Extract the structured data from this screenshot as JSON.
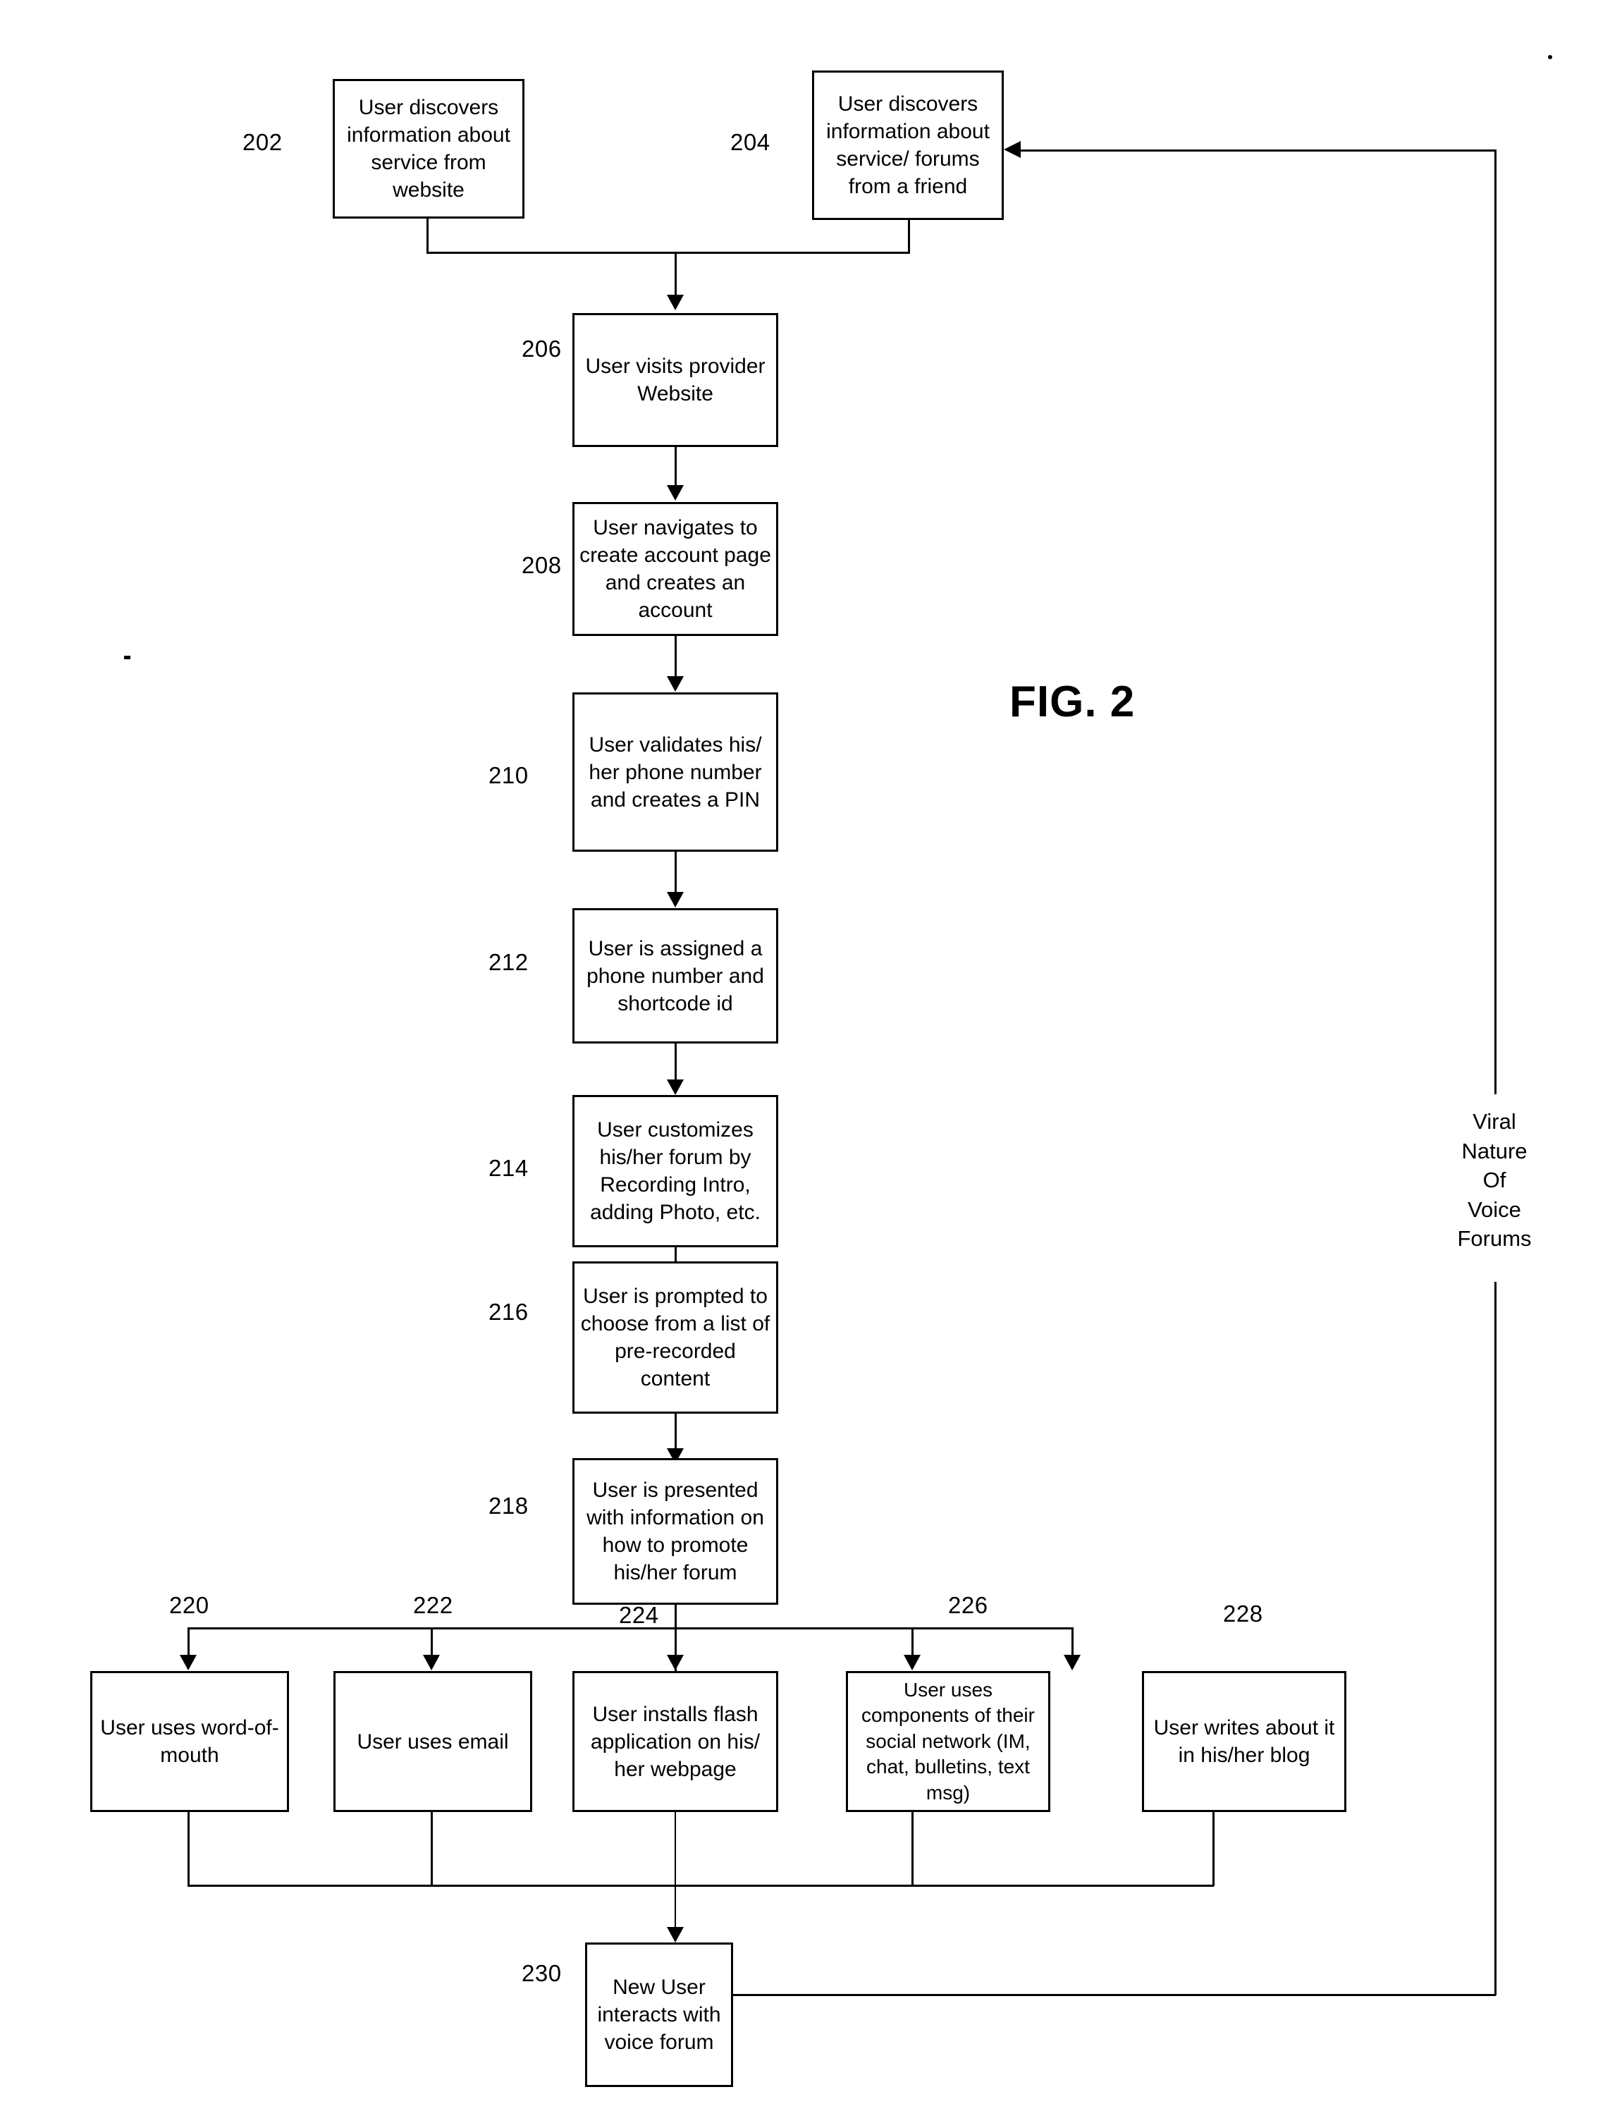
{
  "figure": {
    "label": "FIG. 2",
    "annotation": "Viral\nNature\nOf\nVoice\nForums"
  },
  "nodes": [
    {
      "ref": "202",
      "text": "User discovers information about service from website"
    },
    {
      "ref": "204",
      "text": "User discovers information about service/ forums from a friend"
    },
    {
      "ref": "206",
      "text": "User visits provider Website"
    },
    {
      "ref": "208",
      "text": "User navigates to create account page and creates an account"
    },
    {
      "ref": "210",
      "text": "User validates his/ her phone number and creates a PIN"
    },
    {
      "ref": "212",
      "text": "User is assigned a phone number and shortcode id"
    },
    {
      "ref": "214",
      "text": "User customizes his/her forum by Recording Intro, adding Photo, etc."
    },
    {
      "ref": "216",
      "text": "User is prompted to choose from a list of pre-recorded content"
    },
    {
      "ref": "218",
      "text": "User is presented with information on how to promote his/her forum"
    },
    {
      "ref": "220",
      "text": "User uses word-of-mouth"
    },
    {
      "ref": "222",
      "text": "User uses email"
    },
    {
      "ref": "224",
      "text": "User installs flash application on his/ her webpage"
    },
    {
      "ref": "226",
      "text": "User uses components of their social network (IM, chat, bulletins, text msg)"
    },
    {
      "ref": "228",
      "text": "User writes about it in his/her blog"
    },
    {
      "ref": "230",
      "text": "New User interacts with voice forum"
    }
  ],
  "colors": {
    "stroke": "#000000",
    "background": "#ffffff"
  }
}
